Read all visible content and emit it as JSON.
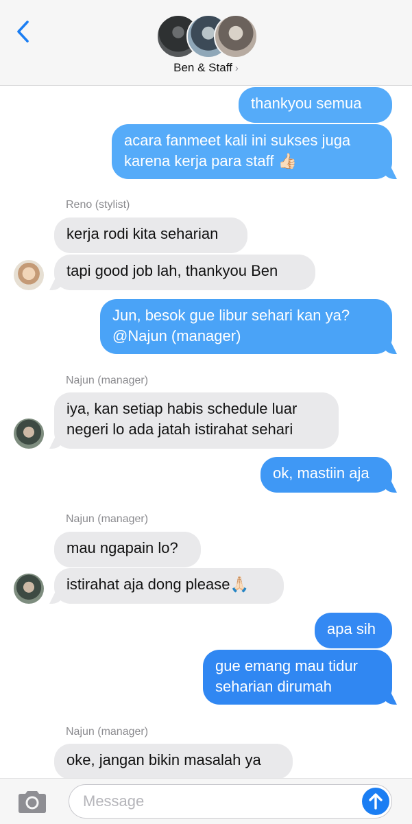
{
  "header": {
    "title": "Ben & Staff",
    "chevron": "›"
  },
  "colors": {
    "me_bubble": "#4aa6f8",
    "me_bubble_deep": "#2f86f2",
    "them_bubble": "#e9e9eb",
    "accent": "#1b7ef3"
  },
  "messages": {
    "m1": "thankyou semua",
    "m2a": "acara fanmeet kali ini sukses juga",
    "m2b": "karena kerja para staff 👍🏻",
    "s1": "Reno (stylist)",
    "m3": "kerja rodi kita seharian",
    "m4": "tapi good job lah, thankyou Ben",
    "m5a": "Jun, besok gue libur sehari kan ya?",
    "m5b": "@Najun (manager)",
    "s2": "Najun (manager)",
    "m6a": "iya, kan setiap habis schedule luar",
    "m6b": "negeri lo ada jatah istirahat sehari",
    "m7": "ok, mastiin aja",
    "s3": "Najun (manager)",
    "m8": "mau ngapain lo?",
    "m9": "istirahat aja dong please🙏🏻",
    "m10": "apa sih",
    "m11a": "gue emang mau tidur",
    "m11b": "seharian dirumah",
    "s4": "Najun (manager)",
    "m12": "oke, jangan bikin masalah ya"
  },
  "composer": {
    "placeholder": "Message"
  },
  "icons": {
    "back": "chevron-left-icon",
    "camera": "camera-icon",
    "send": "arrow-up-icon"
  }
}
